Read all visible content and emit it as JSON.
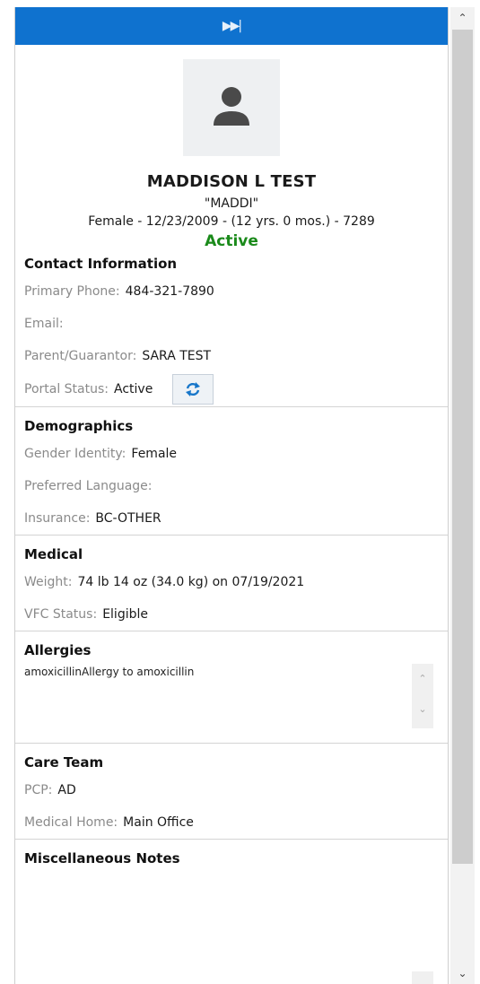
{
  "patient": {
    "name": "MADDISON L TEST",
    "nickname": "\"MADDI\"",
    "summary": "Female - 12/23/2009 - (12 yrs. 0 mos.) - 7289",
    "status": "Active"
  },
  "contact": {
    "title": "Contact Information",
    "primary_phone_label": "Primary Phone:",
    "primary_phone_value": "484-321-7890",
    "email_label": "Email:",
    "email_value": "",
    "guarantor_label": "Parent/Guarantor:",
    "guarantor_value": "SARA TEST",
    "portal_label": "Portal Status:",
    "portal_value": "Active"
  },
  "demographics": {
    "title": "Demographics",
    "gender_label": "Gender Identity:",
    "gender_value": "Female",
    "language_label": "Preferred Language:",
    "language_value": "",
    "insurance_label": "Insurance:",
    "insurance_value": "BC-OTHER"
  },
  "medical": {
    "title": "Medical",
    "weight_label": "Weight:",
    "weight_value": "74 lb 14 oz (34.0 kg) on 07/19/2021",
    "vfc_label": "VFC Status:",
    "vfc_value": "Eligible"
  },
  "allergies": {
    "title": "Allergies",
    "text": "amoxicillinAllergy to amoxicillin"
  },
  "care_team": {
    "title": "Care Team",
    "pcp_label": "PCP:",
    "pcp_value": "AD",
    "home_label": "Medical Home:",
    "home_value": "Main Office"
  },
  "misc": {
    "title": "Miscellaneous Notes"
  },
  "icons": {
    "collapse": "skip-forward-icon",
    "avatar": "user-placeholder-icon",
    "refresh": "refresh-icon"
  },
  "colors": {
    "header_bar": "#0f72cf",
    "status_active": "#1a8a1a",
    "label_gray": "#8a8a8a"
  }
}
